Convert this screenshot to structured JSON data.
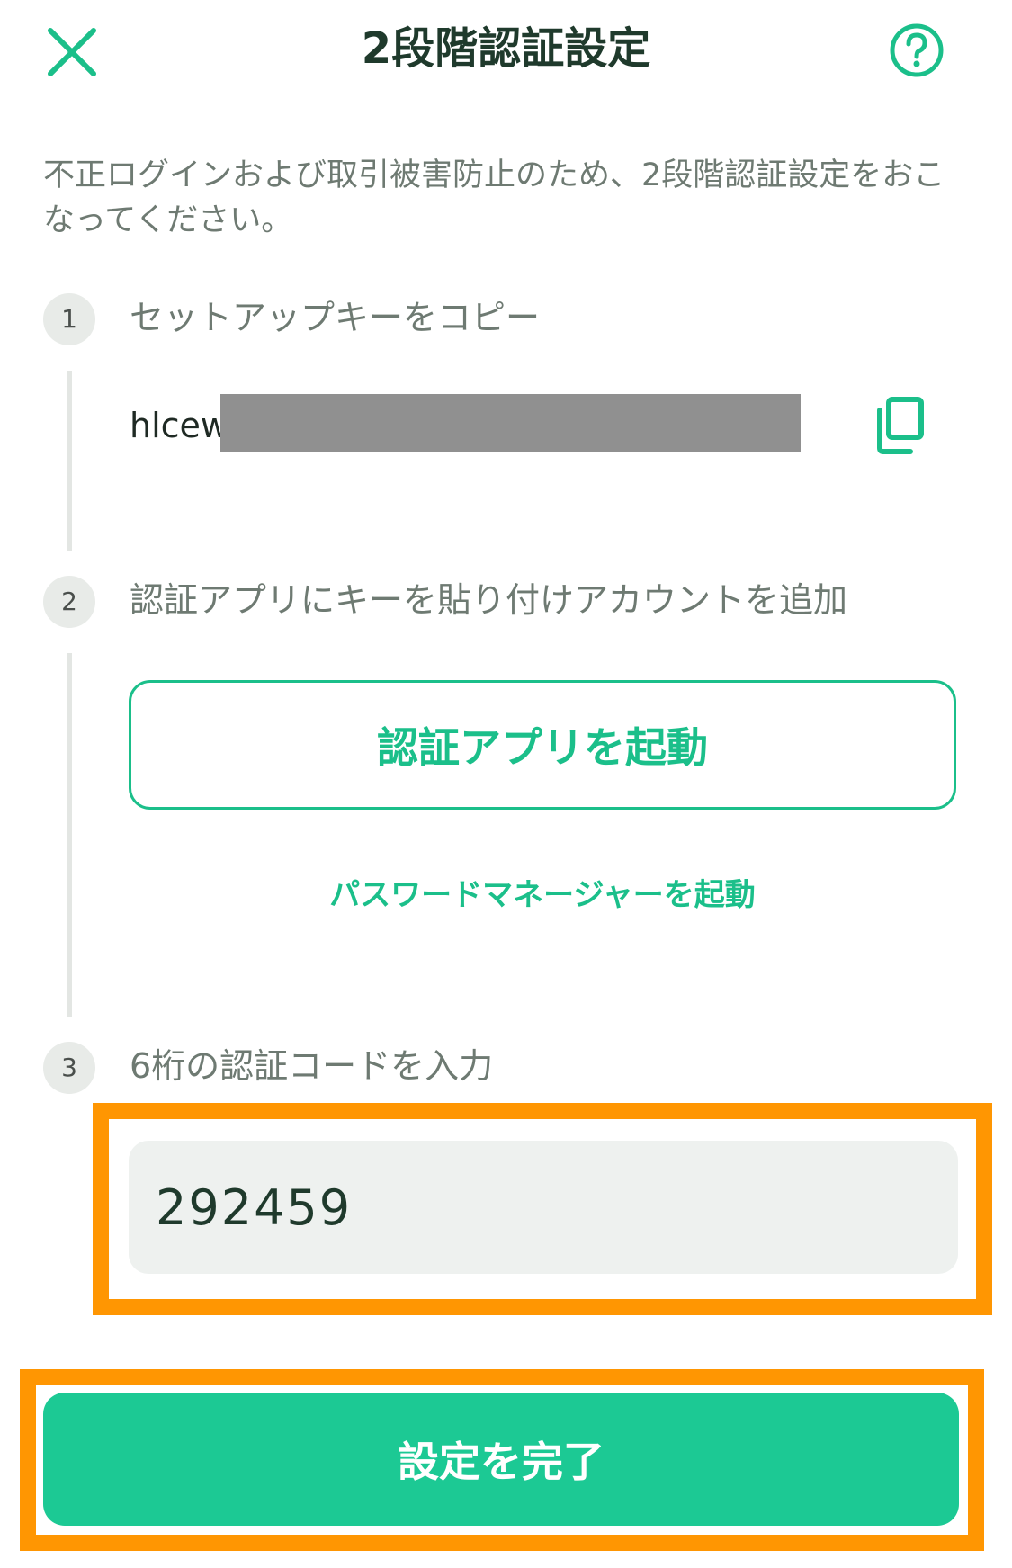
{
  "header": {
    "title": "2段階認証設定",
    "close_icon": "close-icon",
    "help_icon": "question-icon"
  },
  "intro": "不正ログインおよび取引被害防止のため、2段階認証設定をおこなってください。",
  "steps": [
    {
      "number": "1",
      "label": "セットアップキーをコピー"
    },
    {
      "number": "2",
      "label": "認証アプリにキーを貼り付けアカウントを追加"
    },
    {
      "number": "3",
      "label": "6桁の認証コードを入力"
    }
  ],
  "setup_key": {
    "visible_prefix": "hlcew",
    "copy_icon": "copy-icon"
  },
  "buttons": {
    "launch_auth_app": "認証アプリを起動",
    "launch_password_manager": "パスワードマネージャーを起動",
    "complete": "設定を完了"
  },
  "code_input": {
    "value": "292459"
  },
  "colors": {
    "accent": "#1bbf8a",
    "primary_button": "#1cc994",
    "highlight": "#ff9602",
    "header_text": "#1f3a2c"
  }
}
